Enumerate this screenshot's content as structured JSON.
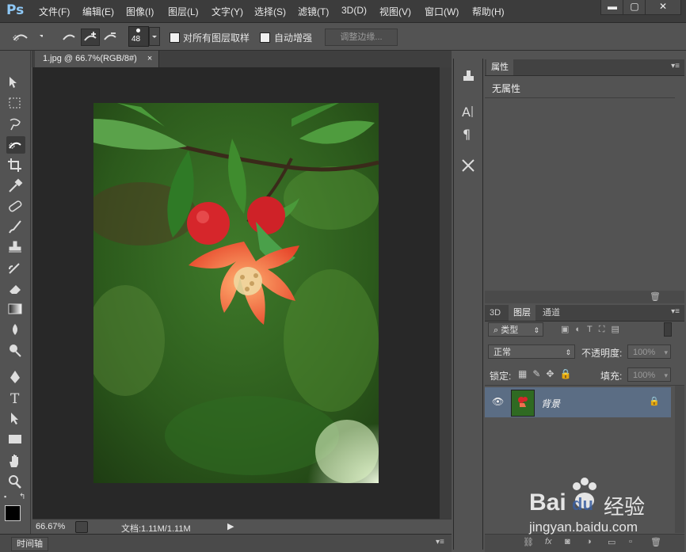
{
  "app": {
    "logo": "Ps"
  },
  "menu": [
    "文件(F)",
    "编辑(E)",
    "图像(I)",
    "图层(L)",
    "文字(Y)",
    "选择(S)",
    "滤镜(T)",
    "3D(D)",
    "视图(V)",
    "窗口(W)",
    "帮助(H)"
  ],
  "window_controls": {
    "minimize": "▬",
    "maximize": "▢",
    "close": "✕"
  },
  "options": {
    "brush_size": "48",
    "sample_all_layers": "对所有图层取样",
    "auto_enhance": "自动增强",
    "refine_edge": "调整边缘..."
  },
  "document": {
    "tab_title": "1.jpg @ 66.7%(RGB/8#)",
    "tab_close": "×",
    "zoom": "66.67%",
    "doc_info": "文档:1.11M/1.11M",
    "status_arrow": "▶"
  },
  "timeline": {
    "label": "时间轴"
  },
  "properties_panel": {
    "tab": "属性",
    "content": "无属性"
  },
  "layers_panel": {
    "tabs": [
      "3D",
      "图层",
      "通道"
    ],
    "active_tab": "图层",
    "filter_kind": "类型",
    "blend_mode": "正常",
    "opacity_label": "不透明度:",
    "opacity_value": "100%",
    "lock_label": "锁定:",
    "fill_label": "填充:",
    "fill_value": "100%",
    "layer_name": "背景"
  },
  "watermark": {
    "brand": "Bai",
    "brand2": "du",
    "cn": "经验",
    "url": "jingyan.baidu.com"
  },
  "colors": {
    "accent": "#8ec8f6",
    "selected_layer": "#5b6d84",
    "canvas_bg": "#282828",
    "panel_bg": "#535353"
  }
}
